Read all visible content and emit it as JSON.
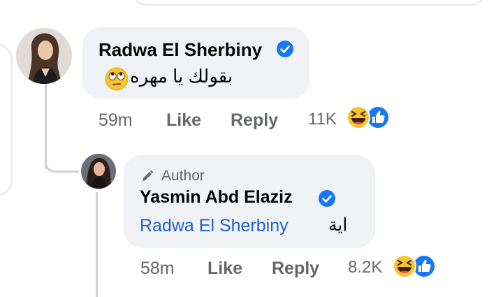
{
  "colors": {
    "bubble": "#f0f2f5",
    "meta_text": "#65676b",
    "verified": "#1877f2",
    "mention": "#1d64c8",
    "thread_line": "#ced0d4"
  },
  "comment": {
    "author": "Radwa El Sherbiny",
    "text": "بقولك يا مهره",
    "emoji": "face-with-rolling-eyes",
    "time": "59m",
    "like_label": "Like",
    "reply_label": "Reply",
    "reaction_count": "11K",
    "reactions": [
      "haha-icon",
      "like-icon"
    ]
  },
  "reply": {
    "badge": "Author",
    "badge_icon": "pencil-icon",
    "author": "Yasmin Abd Elaziz",
    "mention": "Radwa El Sherbiny",
    "text": "اية",
    "time": "58m",
    "like_label": "Like",
    "reply_label": "Reply",
    "reaction_count": "8.2K",
    "reactions": [
      "haha-icon",
      "like-icon"
    ]
  }
}
